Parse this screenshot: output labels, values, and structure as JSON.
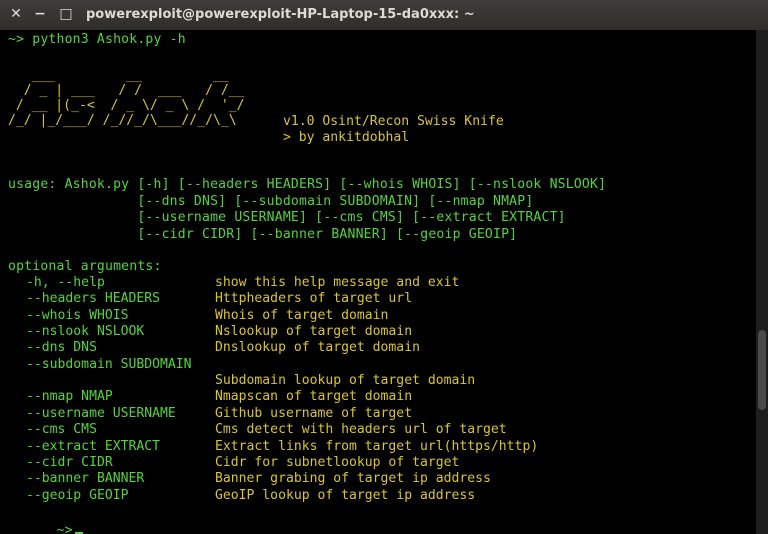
{
  "window": {
    "title": "powerexploit@powerexploit-HP-Laptop-15-da0xxx: ~",
    "close_glyph": "✕",
    "minimize_glyph": "−",
    "maximize_glyph": "□"
  },
  "terminal": {
    "command": "~> python3 Ashok.py -h",
    "banner_ascii": "   ___         __         __\n  / _ | ___   / /  ___   / /__\n / __ |(_-<  / _ \\/ _ \\ /  '_/\n/_/ |_/___/ /_//_/\\___//_/\\_\\",
    "version": "v1.0 Osint/Recon Swiss Knife",
    "author": "> by ankitdobhal",
    "usage": [
      "usage: Ashok.py [-h] [--headers HEADERS] [--whois WHOIS] [--nslook NSLOOK]",
      "                [--dns DNS] [--subdomain SUBDOMAIN] [--nmap NMAP]",
      "                [--username USERNAME] [--cms CMS] [--extract EXTRACT]",
      "                [--cidr CIDR] [--banner BANNER] [--geoip GEOIP]"
    ],
    "optional_header": "optional arguments:",
    "options": [
      {
        "flag": "-h, --help",
        "desc": "show this help message and exit"
      },
      {
        "flag": "--headers HEADERS",
        "desc": "Httpheaders of target url"
      },
      {
        "flag": "--whois WHOIS",
        "desc": "Whois of target domain"
      },
      {
        "flag": "--nslook NSLOOK",
        "desc": "Nslookup of target domain"
      },
      {
        "flag": "--dns DNS",
        "desc": "Dnslookup of target domain"
      },
      {
        "flag": "--subdomain SUBDOMAIN",
        "desc": ""
      },
      {
        "flag": "",
        "desc": "Subdomain lookup of target domain"
      },
      {
        "flag": "--nmap NMAP",
        "desc": "Nmapscan of target domain"
      },
      {
        "flag": "--username USERNAME",
        "desc": "Github username of target"
      },
      {
        "flag": "--cms CMS",
        "desc": "Cms detect with headers url of target"
      },
      {
        "flag": "--extract EXTRACT",
        "desc": "Extract links from target url(https/http)"
      },
      {
        "flag": "--cidr CIDR",
        "desc": "Cidr for subnetlookup of target"
      },
      {
        "flag": "--banner BANNER",
        "desc": "Banner grabing of target ip address"
      },
      {
        "flag": "--geoip GEOIP",
        "desc": "GeoIP lookup of target ip address"
      }
    ],
    "prompt": "~>"
  },
  "colors": {
    "green": "#55d43a",
    "yellow": "#d9c531",
    "background": "#000000"
  }
}
